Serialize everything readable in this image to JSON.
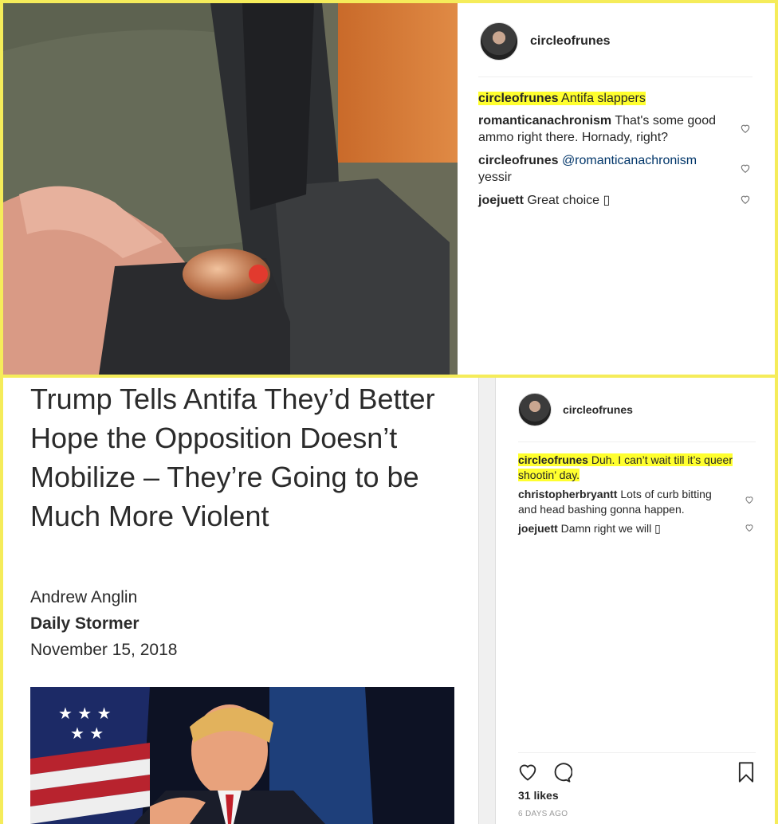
{
  "top_post": {
    "username": "circleofrunes",
    "comments": [
      {
        "user": "circleofrunes",
        "text": "Antifa slappers",
        "highlight": true
      },
      {
        "user": "romanticanachronism",
        "text": "That's some good ammo right there. Hornady, right?"
      },
      {
        "user": "circleofrunes",
        "mention": "@romanticanachronism",
        "text": "yessir"
      },
      {
        "user": "joejuett",
        "text": "Great choice ▯"
      }
    ]
  },
  "article": {
    "headline": "Trump Tells Antifa They’d Better Hope the Opposition Doesn’t Mobilize – They’re Going to be Much More Violent",
    "author": "Andrew Anglin",
    "source": "Daily Stormer",
    "date": "November 15, 2018"
  },
  "bottom_post": {
    "username": "circleofrunes",
    "comments": [
      {
        "user": "circleofrunes",
        "text": "Duh. I can’t wait till it’s queer shootin’ day.",
        "highlight": true
      },
      {
        "user": "christopherbryantt",
        "text": "Lots of curb bitting and head bashing gonna happen."
      },
      {
        "user": "joejuett",
        "text": "Damn right we will ▯"
      }
    ],
    "likes": "31 likes",
    "time_ago": "6 DAYS AGO"
  },
  "icons": [
    "heart-icon",
    "comment-icon",
    "bookmark-icon"
  ],
  "colors": {
    "highlight": "#ffff2e",
    "border": "#f5ec5a",
    "mention": "#003569"
  }
}
